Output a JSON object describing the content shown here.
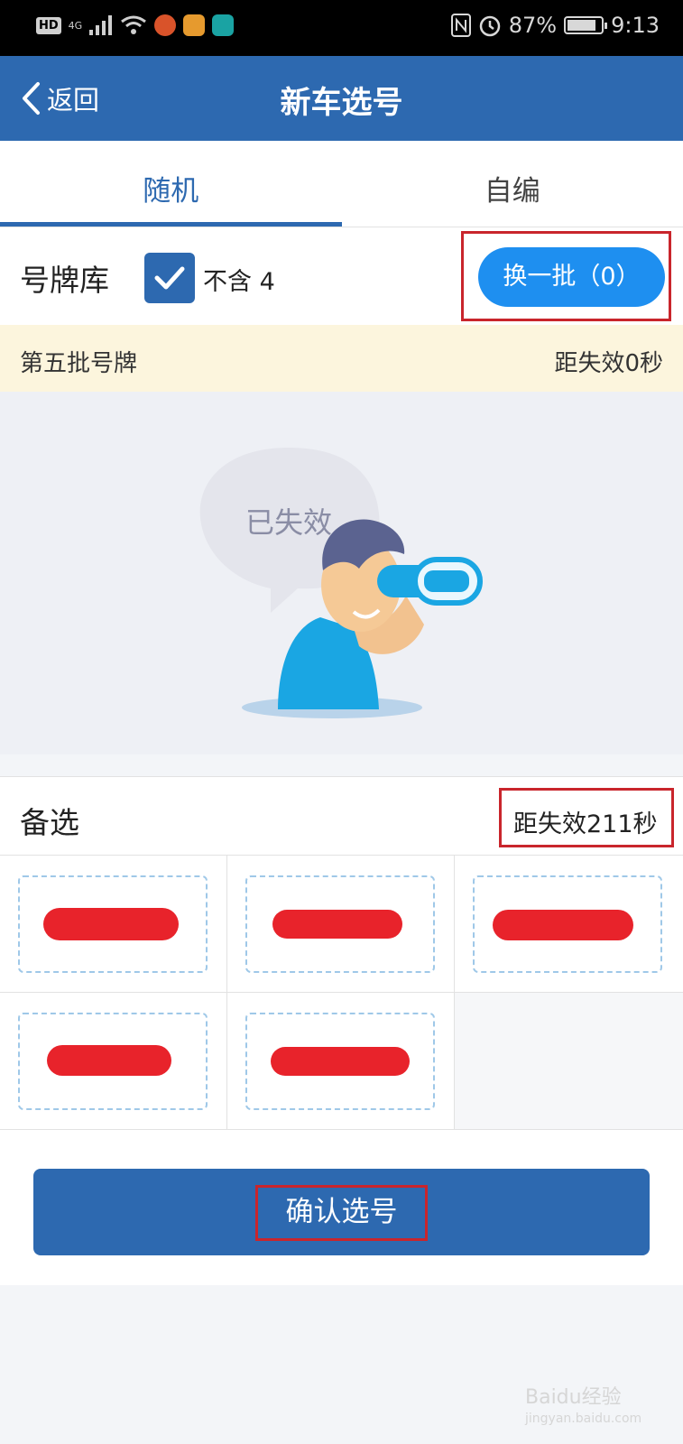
{
  "status_bar": {
    "hd": "HD",
    "network": "4G",
    "battery_percent": "87%",
    "battery_level": 0.87,
    "time": "9:13"
  },
  "header": {
    "back_label": "返回",
    "title": "新车选号"
  },
  "tabs": [
    {
      "label": "随机",
      "active": true
    },
    {
      "label": "自编",
      "active": false
    }
  ],
  "plate_library": {
    "title": "号牌库",
    "exclude_four_checked": true,
    "exclude_four_label": "不含 4",
    "swap_button": "换一批（0）"
  },
  "batch": {
    "name": "第五批号牌",
    "expiry": "距失效0秒"
  },
  "illustration": {
    "bubble_text": "已失效"
  },
  "alternates": {
    "title": "备选",
    "expiry": "距失效211秒",
    "plates": [
      "redacted",
      "redacted",
      "redacted",
      "redacted",
      "redacted"
    ]
  },
  "confirm_button": "确认选号",
  "watermark": {
    "text": "Baidu经验",
    "sub": "jingyan.baidu.com"
  },
  "colors": {
    "primary": "#2d69b0",
    "button_blue": "#1e8ff0",
    "batch_bg": "#fcf5dd",
    "highlight_red": "#c9252c",
    "redaction_red": "#e8232b"
  }
}
